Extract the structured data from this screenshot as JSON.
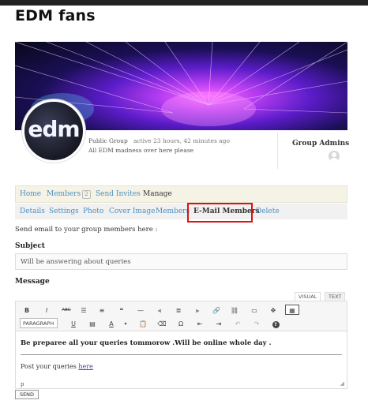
{
  "group": {
    "name": "EDM fans",
    "avatar_text": "edm",
    "type": "Public Group",
    "activity": "active 23 hours, 42 minutes ago",
    "description": "All EDM madness over here please"
  },
  "admins": {
    "title": "Group Admins"
  },
  "main_nav": {
    "items": [
      {
        "label": "Home"
      },
      {
        "label": "Members",
        "count": "2"
      },
      {
        "label": "Send Invites"
      },
      {
        "label": "Manage",
        "current": true
      }
    ]
  },
  "manage_nav": {
    "items": [
      {
        "label": "Details"
      },
      {
        "label": "Settings"
      },
      {
        "label": "Photo"
      },
      {
        "label": "Cover Image"
      },
      {
        "label": "Members"
      },
      {
        "label": "E-Mail Members",
        "current": true,
        "highlight_color": "#e01010"
      },
      {
        "label": "Delete"
      }
    ]
  },
  "form": {
    "intro": "Send email to your group members here :",
    "subject_label": "Subject",
    "subject_value": "Will be answering about queries",
    "message_label": "Message",
    "tabs": {
      "visual": "VISUAL",
      "text": "TEXT"
    },
    "toolbar": {
      "bold": "B",
      "italic": "I",
      "strike": "ABC",
      "format_select": "PARAGRAPH",
      "underline": "U",
      "text_color": "A",
      "omega": "Ω",
      "help": "?"
    },
    "editor": {
      "line1": "Be preparee all your queries tommorow .Will be online whole day .",
      "line2_prefix": "Post your queries ",
      "line2_link": "here",
      "status": "p"
    },
    "send_label": "SEND"
  },
  "colors": {
    "link": "#4a8fc0",
    "highlight": "#e01010"
  }
}
